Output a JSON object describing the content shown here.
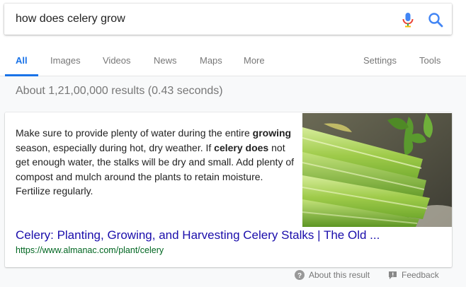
{
  "search": {
    "query": "how does celery grow"
  },
  "tabs": [
    {
      "label": "All"
    },
    {
      "label": "Images"
    },
    {
      "label": "Videos"
    },
    {
      "label": "News"
    },
    {
      "label": "Maps"
    },
    {
      "label": "More"
    }
  ],
  "tools": {
    "settings_label": "Settings",
    "tools_label": "Tools"
  },
  "result_stats": "About 1,21,00,000 results (0.43 seconds)",
  "featured_snippet": {
    "text_parts": [
      {
        "text": "Make sure to provide plenty of water during the entire ",
        "bold": false
      },
      {
        "text": "growing",
        "bold": true
      },
      {
        "text": " season, especially during hot, dry weather. If ",
        "bold": false
      },
      {
        "text": "celery does",
        "bold": true
      },
      {
        "text": " not get enough water, the stalks will be dry and small. Add plenty of compost and mulch around the plants to retain moisture. Fertilize regularly.",
        "bold": false
      }
    ],
    "image_subject": "celery-stalks-photo",
    "title": "Celery: Planting, Growing, and Harvesting Celery Stalks | The Old ...",
    "url": "https://www.almanac.com/plant/celery"
  },
  "footer": {
    "about_label": "About this result",
    "feedback_label": "Feedback"
  },
  "colors": {
    "accent": "#1a73e8",
    "link": "#1a0dab",
    "url": "#006621",
    "muted": "#777777"
  }
}
